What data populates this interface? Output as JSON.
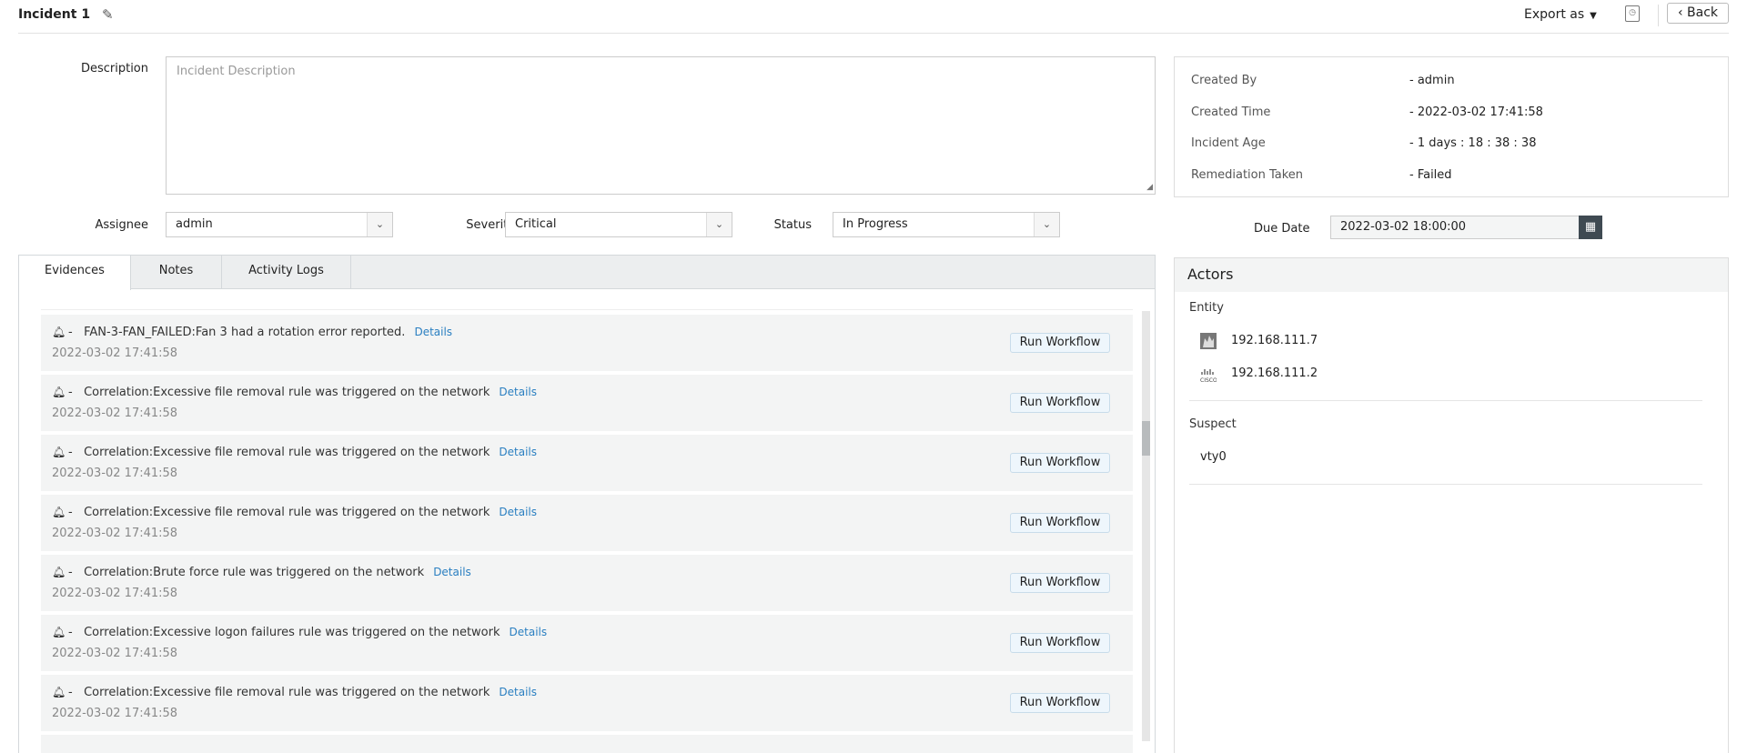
{
  "header": {
    "title": "Incident 1",
    "export_label": "Export as",
    "back_label": "Back"
  },
  "form": {
    "description_label": "Description",
    "description_placeholder": "Incident Description",
    "assignee_label": "Assignee",
    "assignee_value": "admin",
    "severity_label": "Severity",
    "severity_value": "Critical",
    "status_label": "Status",
    "status_value": "In Progress"
  },
  "info": [
    {
      "label": "Created By",
      "value": "- admin"
    },
    {
      "label": "Created Time",
      "value": "- 2022-03-02 17:41:58"
    },
    {
      "label": "Incident Age",
      "value": "- 1 days : 18 : 38 : 38"
    },
    {
      "label": "Remediation Taken",
      "value": "- Failed"
    }
  ],
  "due": {
    "label": "Due Date",
    "value": "2022-03-02 18:00:00"
  },
  "tabs": [
    "Evidences",
    "Notes",
    "Activity Logs"
  ],
  "evidences": [
    {
      "msg": "FAN-3-FAN_FAILED:Fan 3 had a rotation error reported.",
      "ts": "2022-03-02 17:41:58"
    },
    {
      "msg": "Correlation:Excessive file removal rule was triggered on the network",
      "ts": "2022-03-02 17:41:58"
    },
    {
      "msg": "Correlation:Excessive file removal rule was triggered on the network",
      "ts": "2022-03-02 17:41:58"
    },
    {
      "msg": "Correlation:Excessive file removal rule was triggered on the network",
      "ts": "2022-03-02 17:41:58"
    },
    {
      "msg": "Correlation:Brute force rule was triggered on the network",
      "ts": "2022-03-02 17:41:58"
    },
    {
      "msg": "Correlation:Excessive logon failures rule was triggered on the network",
      "ts": "2022-03-02 17:41:58"
    },
    {
      "msg": "Correlation:Excessive file removal rule was triggered on the network",
      "ts": "2022-03-02 17:41:58"
    }
  ],
  "evidence_labels": {
    "separator": "-",
    "details": "Details",
    "run": "Run Workflow"
  },
  "actors": {
    "title": "Actors",
    "entity_label": "Entity",
    "entities": [
      {
        "ip": "192.168.111.7",
        "icon": "firewall-icon"
      },
      {
        "ip": "192.168.111.2",
        "icon": "cisco-icon"
      }
    ],
    "suspect_label": "Suspect",
    "suspects": [
      "vty0"
    ]
  }
}
